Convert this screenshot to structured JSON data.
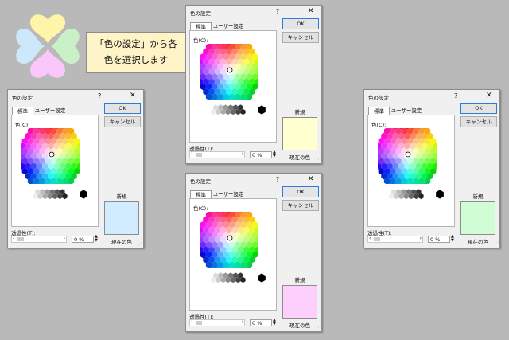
{
  "callout": {
    "line1": "「色の設定」から各",
    "line2": "色を選択します"
  },
  "dialog": {
    "title": "色の設定",
    "help": "?",
    "close": "✕",
    "tab_standard": "標準",
    "tab_user": "ユーザー設定",
    "color_label": "色(C):",
    "ok": "OK",
    "cancel": "キャンセル",
    "new_label": "新規",
    "current_label": "現在の色",
    "transparency_label": "透過性(T):",
    "transparency_value": "0 %",
    "slider_left": "‹",
    "slider_right": "›",
    "spin_up": "▲",
    "spin_down": "▼"
  },
  "dialogs": [
    {
      "id": "top",
      "new_color": "#ffffd0"
    },
    {
      "id": "left",
      "new_color": "#d0ecfe"
    },
    {
      "id": "middle",
      "new_color": "#fdcffd"
    },
    {
      "id": "right",
      "new_color": "#d0fdd4"
    }
  ],
  "colors": {
    "logo": [
      "#fff5a8",
      "#fac7fb",
      "#c9f0c6",
      "#cde8fb"
    ]
  }
}
